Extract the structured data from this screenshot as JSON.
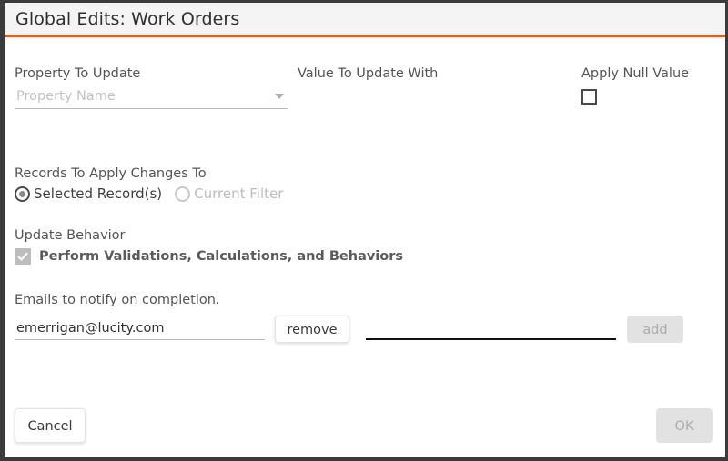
{
  "window": {
    "title": "Global Edits: Work Orders",
    "accent_color": "#ef5b14",
    "titlebar_bg": "#f4f4f4",
    "border_color": "#3b3b3b"
  },
  "form": {
    "property": {
      "label": "Property To Update",
      "value": "",
      "placeholder": "Property Name",
      "caret_icon": "chevron-down-icon"
    },
    "value_to_update": {
      "label": "Value To Update With",
      "value": "",
      "placeholder": ""
    },
    "apply_null": {
      "label": "Apply Null Value",
      "checked": false
    },
    "records": {
      "label": "Records To Apply Changes To",
      "options": [
        {
          "label": "Selected Record(s)",
          "selected": true,
          "disabled": false
        },
        {
          "label": "Current Filter",
          "selected": false,
          "disabled": true
        }
      ]
    },
    "update_behavior": {
      "label": "Update Behavior",
      "checkbox_label": "Perform Validations, Calculations, and Behaviors",
      "checked": true,
      "disabled": true
    },
    "emails": {
      "label": "Emails to notify on completion.",
      "existing": {
        "value": "emerrigan@lucity.com",
        "placeholder": "",
        "remove_label": "remove"
      },
      "new": {
        "value": "",
        "placeholder": "",
        "add_label": "add",
        "add_disabled": true
      }
    }
  },
  "footer": {
    "cancel_label": "Cancel",
    "ok_label": "OK",
    "ok_disabled": true
  }
}
